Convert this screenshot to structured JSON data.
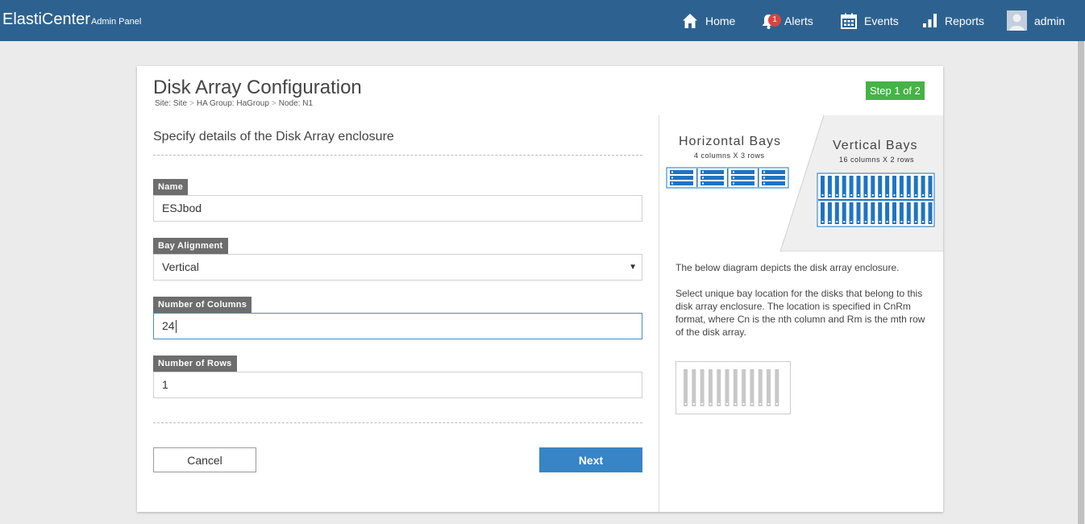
{
  "app": {
    "title": "ElastiCenter",
    "subtitle": "Admin Panel"
  },
  "nav": {
    "home": "Home",
    "alerts": "Alerts",
    "alerts_count": "1",
    "events": "Events",
    "reports": "Reports",
    "user": "admin"
  },
  "page": {
    "title": "Disk Array Configuration",
    "breadcrumb": [
      "Site: Site",
      "HA Group: HaGroup",
      "Node: N1"
    ],
    "breadcrumb_sep": ">",
    "step": "Step 1 of 2",
    "section_title": "Specify details of the Disk Array enclosure"
  },
  "form": {
    "name": {
      "label": "Name",
      "value": "ESJbod"
    },
    "bay_alignment": {
      "label": "Bay Alignment",
      "value": "Vertical",
      "arrow": "▼"
    },
    "columns": {
      "label": "Number of Columns",
      "value": "24"
    },
    "rows": {
      "label": "Number of Rows",
      "value": "1"
    },
    "cancel": "Cancel",
    "next": "Next"
  },
  "diagram": {
    "horizontal_title": "Horizontal Bays",
    "horizontal_sub": "4 columns X 3 rows",
    "vertical_title": "Vertical Bays",
    "vertical_sub": "16 columns X 2 rows",
    "description_1": "The below diagram depicts the disk array enclosure.",
    "description_2": "Select unique bay location for the disks that belong to this disk array enclosure. The location is specified in CnRm format, where Cn is the nth column and Rm is the mth row of the disk array."
  },
  "colors": {
    "topbar": "#2d6290",
    "step_badge": "#45b345",
    "primary_button": "#3785c6",
    "bay_blue": "#1f74c2"
  }
}
